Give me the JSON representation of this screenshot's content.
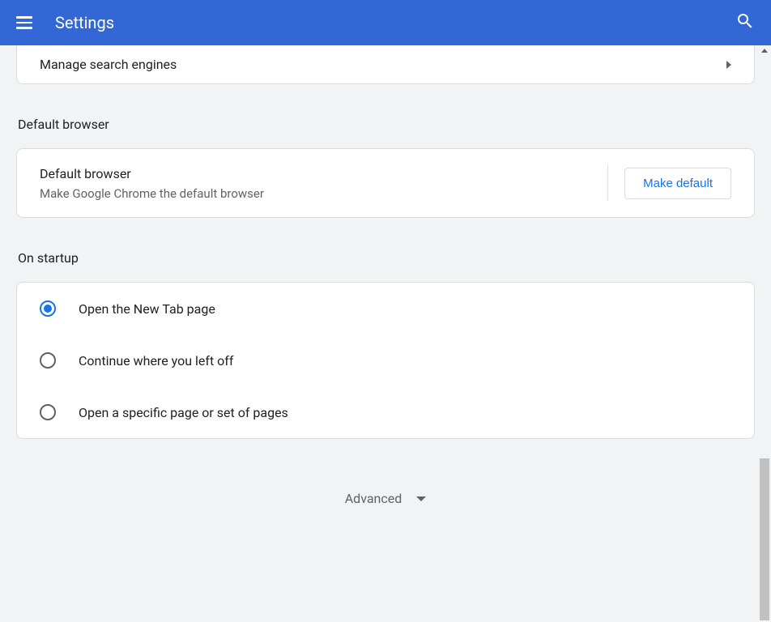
{
  "header": {
    "title": "Settings"
  },
  "search_engine": {
    "manage_label": "Manage search engines"
  },
  "default_browser": {
    "section_title": "Default browser",
    "label": "Default browser",
    "sublabel": "Make Google Chrome the default browser",
    "button": "Make default"
  },
  "on_startup": {
    "section_title": "On startup",
    "options": [
      {
        "label": "Open the New Tab page",
        "selected": true
      },
      {
        "label": "Continue where you left off",
        "selected": false
      },
      {
        "label": "Open a specific page or set of pages",
        "selected": false
      }
    ]
  },
  "advanced": {
    "label": "Advanced"
  }
}
